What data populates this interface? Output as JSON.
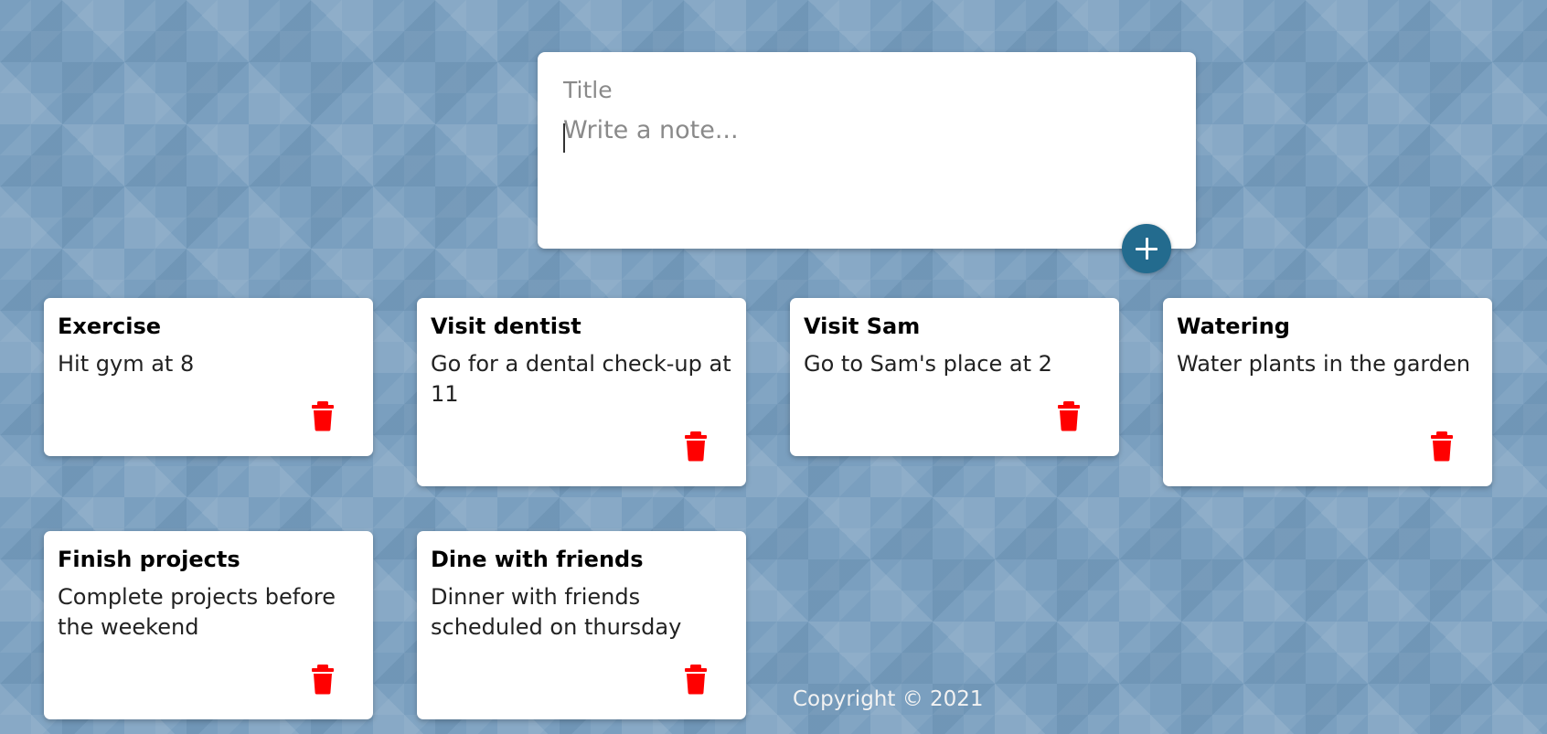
{
  "composer": {
    "title_placeholder": "Title",
    "note_placeholder": "Write a note...",
    "add_icon": "plus-icon"
  },
  "notes": [
    {
      "title": "Exercise",
      "content": "Hit gym at 8"
    },
    {
      "title": "Visit dentist",
      "content": "Go for a dental check-up at 11"
    },
    {
      "title": "Visit Sam",
      "content": "Go to Sam's place at 2"
    },
    {
      "title": "Watering",
      "content": "Water plants in the garden"
    },
    {
      "title": "Finish projects",
      "content": "Complete projects before the weekend"
    },
    {
      "title": "Dine with friends",
      "content": "Dinner with friends scheduled on thursday"
    }
  ],
  "footer": {
    "copyright": "Copyright © 2021"
  },
  "colors": {
    "accent": "#236b8e",
    "delete": "#ff0000",
    "card": "#ffffff",
    "background": "#7a9fbf"
  },
  "icons": {
    "delete": "trash-icon",
    "add": "plus-icon"
  }
}
